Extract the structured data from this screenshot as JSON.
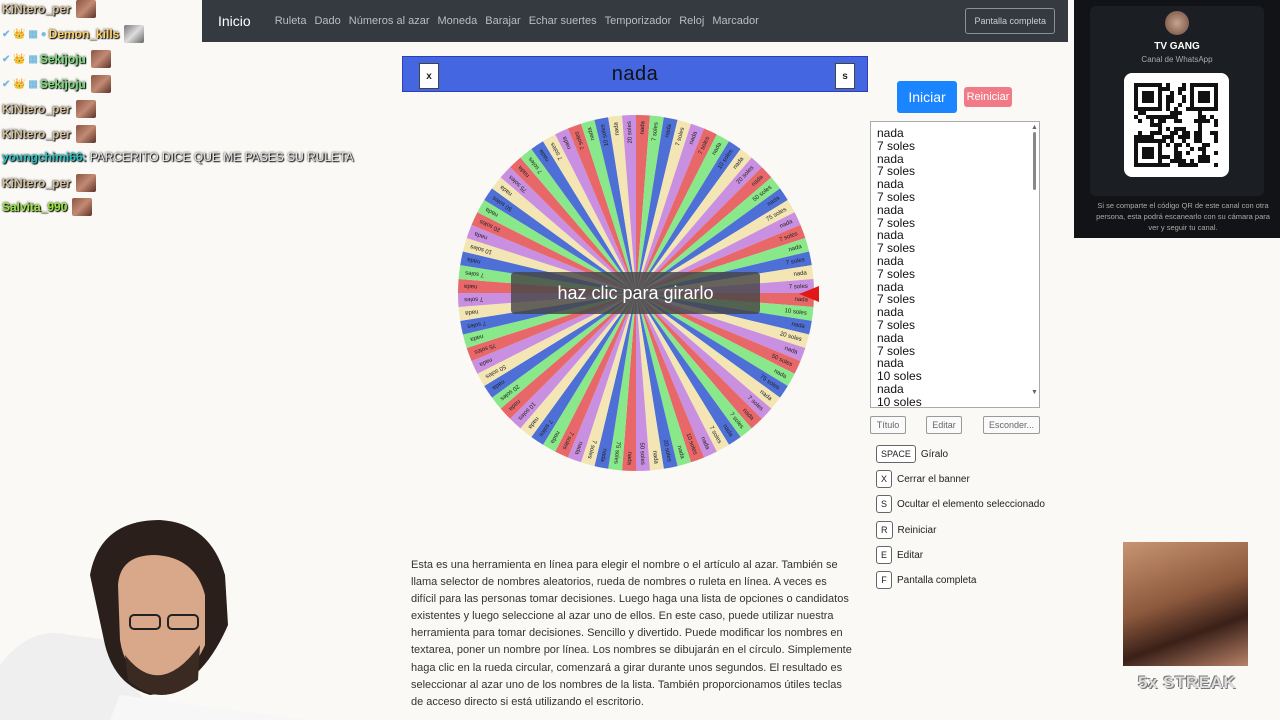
{
  "navbar": {
    "brand": "Inicio",
    "links": [
      "Ruleta",
      "Dado",
      "Números al azar",
      "Moneda",
      "Barajar",
      "Echar suertes",
      "Temporizador",
      "Reloj",
      "Marcador"
    ],
    "fullscreen": "Pantalla completa"
  },
  "chat": [
    {
      "name": "KiNtero_per",
      "color": "#d7c2a0",
      "message": ""
    },
    {
      "name": "Demon_kills",
      "color": "#ffd36b",
      "message": ""
    },
    {
      "name": "Sekijoju",
      "color": "#7ce07c",
      "message": ""
    },
    {
      "name": "Sekijoju",
      "color": "#7ce07c",
      "message": ""
    },
    {
      "name": "KiNtero_per",
      "color": "#d7c2a0",
      "message": ""
    },
    {
      "name": "KiNtero_per",
      "color": "#d7c2a0",
      "message": ""
    },
    {
      "name": "youngchimi66:",
      "color": "#27c1c1",
      "message": "PARCERITO DICE QUE ME PASES SU RULETA"
    },
    {
      "name": "KiNtero_per",
      "color": "#d7c2a0",
      "message": ""
    },
    {
      "name": "Salvita_990",
      "color": "#9be83f",
      "message": ""
    }
  ],
  "banner": {
    "title": "nada",
    "close_key": "x",
    "hide_key": "s"
  },
  "wheel": {
    "spin_label": "haz clic para girarlo",
    "labels": [
      "nada",
      "7 soles",
      "nada",
      "7 soles",
      "nada",
      "7 soles",
      "nada",
      "10 soles",
      "nada",
      "20 soles",
      "nada",
      "50 soles",
      "nada",
      "75 soles"
    ],
    "colors": [
      "#e8686a",
      "#89e889",
      "#4d6fd6",
      "#f3e6b4",
      "#c98fe0"
    ]
  },
  "controls": {
    "start": "Iniciar",
    "reset": "Reiniciar",
    "title_btn": "Título",
    "edit_btn": "Editar",
    "hide_btn": "Esconder..."
  },
  "options_list": [
    "nada",
    "7 soles",
    "nada",
    "7 soles",
    "nada",
    "7 soles",
    "nada",
    "7 soles",
    "nada",
    "7 soles",
    "nada",
    "7 soles",
    "nada",
    "7 soles",
    "nada",
    "7 soles",
    "nada",
    "7 soles",
    "nada",
    "10 soles",
    "nada",
    "10 soles"
  ],
  "shortcuts": [
    {
      "key": "SPACE",
      "label": "Gíralo"
    },
    {
      "key": "X",
      "label": "Cerrar el banner"
    },
    {
      "key": "S",
      "label": "Ocultar el elemento seleccionado"
    },
    {
      "key": "R",
      "label": "Reiniciar"
    },
    {
      "key": "E",
      "label": "Editar"
    },
    {
      "key": "F",
      "label": "Pantalla completa"
    }
  ],
  "description": "Esta es una herramienta en línea para elegir el nombre o el artículo al azar. También se llama selector de nombres aleatorios, rueda de nombres o ruleta en línea. A veces es difícil para las personas tomar decisiones. Luego haga una lista de opciones o candidatos existentes y luego seleccione al azar uno de ellos. En este caso, puede utilizar nuestra herramienta para tomar decisiones. Sencillo y divertido. Puede modificar los nombres en textarea, poner un nombre por línea. Los nombres se dibujarán en el círculo. Simplemente haga clic en la rueda circular, comenzará a girar durante unos segundos. El resultado es seleccionar al azar uno de los nombres de la lista. También proporcionamos útiles teclas de acceso directo si está utilizando el escritorio.",
  "whatsapp": {
    "title": "TV GANG",
    "subtitle": "Canal de WhatsApp",
    "note": "Si se comparte el código QR de este canal con otra persona, esta podrá escanearlo con su cámara para ver y seguir tu canal."
  },
  "streak": "5x STREAK"
}
